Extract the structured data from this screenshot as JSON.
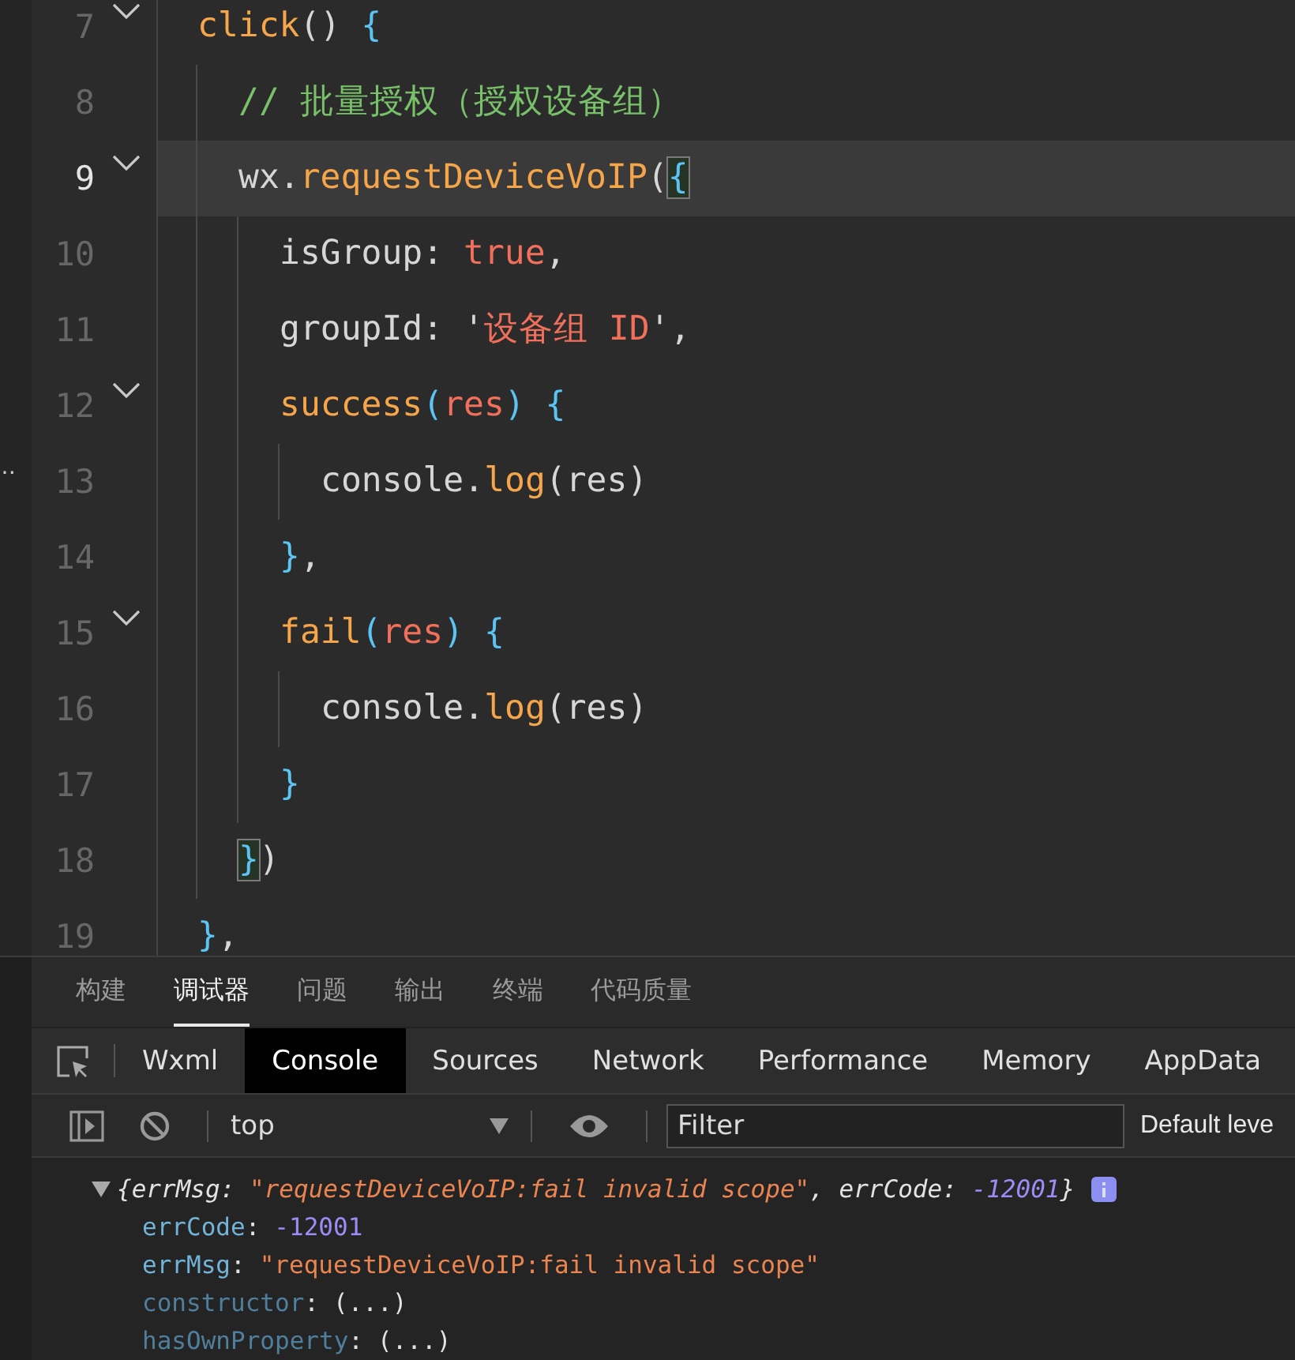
{
  "side_strip": {
    "label": "…"
  },
  "editor": {
    "lines": [
      {
        "number": "7",
        "foldable": true,
        "current": false,
        "tokens": [
          {
            "text": "click",
            "kind": "func"
          },
          {
            "text": "() ",
            "kind": "paren"
          },
          {
            "text": "{",
            "kind": "brace"
          }
        ],
        "children": [
          {
            "number": "8",
            "foldable": false,
            "current": false,
            "tokens": [
              {
                "text": "// 批量授权（授权设备组）",
                "kind": "comment"
              }
            ]
          },
          {
            "number": "9",
            "foldable": true,
            "current": true,
            "tokens": [
              {
                "text": "wx.",
                "kind": "plain"
              },
              {
                "text": "requestDeviceVoIP",
                "kind": "func"
              },
              {
                "text": "(",
                "kind": "paren"
              },
              {
                "text": "{",
                "kind": "brace-match"
              }
            ],
            "children": [
              {
                "number": "10",
                "foldable": false,
                "current": false,
                "tokens": [
                  {
                    "text": "isGroup: ",
                    "kind": "plain"
                  },
                  {
                    "text": "true",
                    "kind": "literal"
                  },
                  {
                    "text": ",",
                    "kind": "plain"
                  }
                ]
              },
              {
                "number": "11",
                "foldable": false,
                "current": false,
                "tokens": [
                  {
                    "text": "groupId: '",
                    "kind": "plain"
                  },
                  {
                    "text": "设备组 ID",
                    "kind": "literal"
                  },
                  {
                    "text": "',",
                    "kind": "plain"
                  }
                ]
              },
              {
                "number": "12",
                "foldable": true,
                "current": false,
                "tokens": [
                  {
                    "text": "success",
                    "kind": "func"
                  },
                  {
                    "text": "(",
                    "kind": "brace"
                  },
                  {
                    "text": "res",
                    "kind": "literal"
                  },
                  {
                    "text": ") ",
                    "kind": "brace"
                  },
                  {
                    "text": "{",
                    "kind": "brace"
                  }
                ],
                "children": [
                  {
                    "number": "13",
                    "foldable": false,
                    "current": false,
                    "tokens": [
                      {
                        "text": "console.",
                        "kind": "plain"
                      },
                      {
                        "text": "log",
                        "kind": "func"
                      },
                      {
                        "text": "(res)",
                        "kind": "plain"
                      }
                    ]
                  }
                ]
              },
              {
                "number": "14",
                "foldable": false,
                "current": false,
                "tokens": [
                  {
                    "text": "}",
                    "kind": "brace"
                  },
                  {
                    "text": ",",
                    "kind": "plain"
                  }
                ]
              },
              {
                "number": "15",
                "foldable": true,
                "current": false,
                "tokens": [
                  {
                    "text": "fail",
                    "kind": "func"
                  },
                  {
                    "text": "(",
                    "kind": "brace"
                  },
                  {
                    "text": "res",
                    "kind": "literal"
                  },
                  {
                    "text": ") ",
                    "kind": "brace"
                  },
                  {
                    "text": "{",
                    "kind": "brace"
                  }
                ],
                "children": [
                  {
                    "number": "16",
                    "foldable": false,
                    "current": false,
                    "tokens": [
                      {
                        "text": "console.",
                        "kind": "plain"
                      },
                      {
                        "text": "log",
                        "kind": "func"
                      },
                      {
                        "text": "(res)",
                        "kind": "plain"
                      }
                    ]
                  }
                ]
              },
              {
                "number": "17",
                "foldable": false,
                "current": false,
                "tokens": [
                  {
                    "text": "}",
                    "kind": "brace"
                  }
                ]
              }
            ]
          },
          {
            "number": "18",
            "foldable": false,
            "current": false,
            "tokens": [
              {
                "text": "}",
                "kind": "brace-match"
              },
              {
                "text": ")",
                "kind": "paren"
              }
            ]
          }
        ]
      },
      {
        "number": "19",
        "foldable": false,
        "current": false,
        "tokens": [
          {
            "text": "}",
            "kind": "brace"
          },
          {
            "text": ",",
            "kind": "plain"
          }
        ]
      }
    ]
  },
  "panel_tabs": [
    {
      "label": "构建",
      "selected": false
    },
    {
      "label": "调试器",
      "selected": true
    },
    {
      "label": "问题",
      "selected": false
    },
    {
      "label": "输出",
      "selected": false
    },
    {
      "label": "终端",
      "selected": false
    },
    {
      "label": "代码质量",
      "selected": false
    }
  ],
  "devtools_tabs": [
    {
      "label": "Wxml",
      "selected": false
    },
    {
      "label": "Console",
      "selected": true
    },
    {
      "label": "Sources",
      "selected": false
    },
    {
      "label": "Network",
      "selected": false
    },
    {
      "label": "Performance",
      "selected": false
    },
    {
      "label": "Memory",
      "selected": false
    },
    {
      "label": "AppData",
      "selected": false
    }
  ],
  "console_toolbar": {
    "context": "top",
    "filter": {
      "placeholder": "Filter"
    },
    "levels": "Default leve"
  },
  "console": {
    "summary": [
      {
        "text": "{errMsg: ",
        "kind": "plain"
      },
      {
        "text": "\"requestDeviceVoIP:fail invalid scope\"",
        "kind": "string"
      },
      {
        "text": ", errCode: ",
        "kind": "plain"
      },
      {
        "text": "-12001",
        "kind": "number"
      },
      {
        "text": "}",
        "kind": "plain"
      }
    ],
    "expanded": true,
    "properties": [
      {
        "key": "errCode",
        "separator": ":",
        "own": true,
        "value": "-12001",
        "kind": "number"
      },
      {
        "key": "errMsg",
        "separator": ":",
        "own": true,
        "value": "\"requestDeviceVoIP:fail invalid scope\"",
        "kind": "string"
      },
      {
        "key": "constructor",
        "separator": ":",
        "own": false,
        "value": "(...)",
        "kind": "plain"
      },
      {
        "key": "hasOwnProperty",
        "separator": ":",
        "own": false,
        "value": "(...)",
        "kind": "plain"
      }
    ]
  }
}
